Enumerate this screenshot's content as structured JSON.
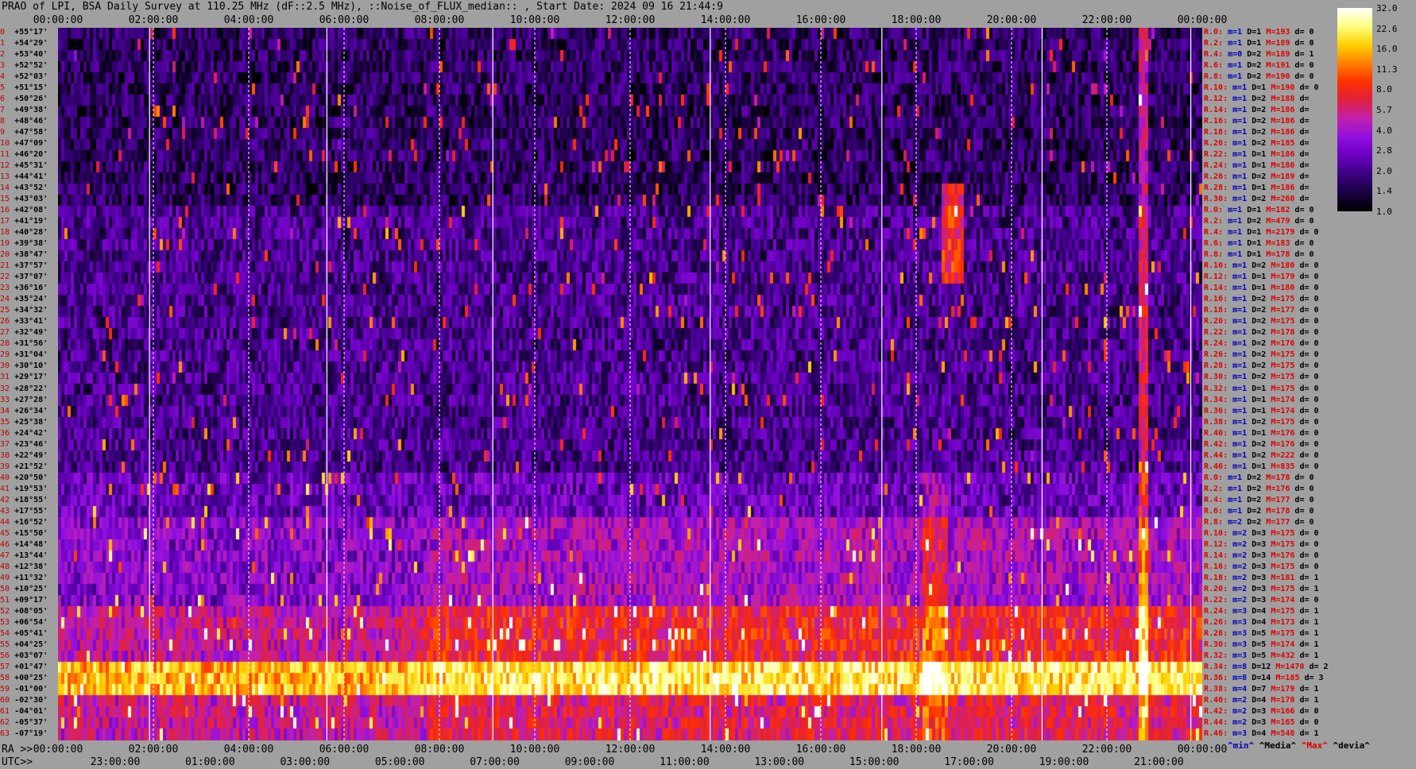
{
  "title": "PRAO of LPI, BSA Daily Survey at 110.25 MHz (dF::2.5 MHz), ::Noise_of_FLUX_median:: , Start Date: 2024 09 16 21:44:9",
  "top_axis": [
    "00:00:00",
    "02:00:00",
    "04:00:00",
    "06:00:00",
    "08:00:00",
    "10:00:00",
    "12:00:00",
    "14:00:00",
    "16:00:00",
    "18:00:00",
    "20:00:00",
    "22:00:00",
    "00:00:00"
  ],
  "ra_prefix": "RA >>",
  "ra_axis": [
    "00:00:00",
    "02:00:00",
    "04:00:00",
    "06:00:00",
    "08:00:00",
    "10:00:00",
    "12:00:00",
    "14:00:00",
    "16:00:00",
    "18:00:00",
    "20:00:00",
    "22:00:00",
    "00:00:00"
  ],
  "utc_prefix": "UTC>>",
  "utc_axis": [
    "23:00:00",
    "01:00:00",
    "03:00:00",
    "05:00:00",
    "07:00:00",
    "09:00:00",
    "11:00:00",
    "13:00:00",
    "15:00:00",
    "17:00:00",
    "19:00:00",
    "21:00:00"
  ],
  "declinations": [
    "+55°17'",
    "+54°29'",
    "+53°40'",
    "+52°52'",
    "+52°03'",
    "+51°15'",
    "+50°26'",
    "+49°38'",
    "+48°46'",
    "+47°58'",
    "+47°09'",
    "+46°20'",
    "+45°31'",
    "+44°41'",
    "+43°52'",
    "+43°03'",
    "+42°08'",
    "+41°19'",
    "+40°28'",
    "+39°38'",
    "+38°47'",
    "+37°57'",
    "+37°07'",
    "+36°16'",
    "+35°24'",
    "+34°32'",
    "+33°41'",
    "+32°49'",
    "+31°56'",
    "+31°04'",
    "+30°10'",
    "+29°17'",
    "+28°22'",
    "+27°28'",
    "+26°34'",
    "+25°38'",
    "+24°42'",
    "+23°46'",
    "+22°49'",
    "+21°52'",
    "+20°50'",
    "+19°53'",
    "+18°55'",
    "+17°55'",
    "+16°52'",
    "+15°50'",
    "+14°48'",
    "+13°44'",
    "+12°38'",
    "+11°32'",
    "+10°25'",
    "+09°17'",
    "+08°05'",
    "+06°54'",
    "+05°41'",
    "+04°25'",
    "+03°07'",
    "+01°47'",
    "+00°25'",
    "-01°00'",
    "-02°30'",
    "-04°01'",
    "-05°37'",
    "-07°19'"
  ],
  "row_indices": [
    "0",
    "1",
    "2",
    "3",
    "4",
    "5",
    "6",
    "7",
    "8",
    "9",
    "10",
    "11",
    "12",
    "13",
    "14",
    "15",
    "16",
    "17",
    "18",
    "19",
    "20",
    "21",
    "22",
    "23",
    "24",
    "25",
    "26",
    "27",
    "28",
    "29",
    "30",
    "31",
    "32",
    "33",
    "34",
    "35",
    "36",
    "37",
    "38",
    "39",
    "40",
    "41",
    "42",
    "43",
    "44",
    "45",
    "46",
    "47",
    "48",
    "49",
    "50",
    "51",
    "52",
    "53",
    "54",
    "55",
    "56",
    "57",
    "58",
    "59",
    "60",
    "61",
    "62",
    "63"
  ],
  "stats_rows": [
    {
      "r": "R.0:",
      "m": "m=1",
      "d": "D=1",
      "M": "M=193",
      "dd": "d= 0"
    },
    {
      "r": "R.2:",
      "m": "m=1",
      "d": "D=1",
      "M": "M=189",
      "dd": "d= 0"
    },
    {
      "r": "R.4:",
      "m": "m=0",
      "d": "D=2",
      "M": "M=189",
      "dd": "d= 1"
    },
    {
      "r": "R.6:",
      "m": "m=1",
      "d": "D=2",
      "M": "M=191",
      "dd": "d= 0"
    },
    {
      "r": "R.8:",
      "m": "m=1",
      "d": "D=2",
      "M": "M=190",
      "dd": "d= 0"
    },
    {
      "r": "R.10:",
      "m": "m=1",
      "d": "D=1",
      "M": "M=190",
      "dd": "d= 0"
    },
    {
      "r": "R.12:",
      "m": "m=1",
      "d": "D=2",
      "M": "M=188",
      "dd": "d="
    },
    {
      "r": "R.14:",
      "m": "m=1",
      "d": "D=2",
      "M": "M=186",
      "dd": "d="
    },
    {
      "r": "R.16:",
      "m": "m=1",
      "d": "D=2",
      "M": "M=186",
      "dd": "d="
    },
    {
      "r": "R.18:",
      "m": "m=1",
      "d": "D=2",
      "M": "M=186",
      "dd": "d="
    },
    {
      "r": "R.20:",
      "m": "m=1",
      "d": "D=2",
      "M": "M=185",
      "dd": "d="
    },
    {
      "r": "R.22:",
      "m": "m=1",
      "d": "D=1",
      "M": "M=186",
      "dd": "d="
    },
    {
      "r": "R.24:",
      "m": "m=1",
      "d": "D=1",
      "M": "M=186",
      "dd": "d="
    },
    {
      "r": "R.26:",
      "m": "m=1",
      "d": "D=2",
      "M": "M=189",
      "dd": "d="
    },
    {
      "r": "R.28:",
      "m": "m=1",
      "d": "D=1",
      "M": "M=186",
      "dd": "d="
    },
    {
      "r": "R.30:",
      "m": "m=1",
      "d": "D=2",
      "M": "M=260",
      "dd": "d="
    },
    {
      "r": "R.0:",
      "m": "m=1",
      "d": "D=1",
      "M": "M=182",
      "dd": "d= 0"
    },
    {
      "r": "R.2:",
      "m": "m=1",
      "d": "D=2",
      "M": "M=479",
      "dd": "d= 0"
    },
    {
      "r": "R.4:",
      "m": "m=1",
      "d": "D=1",
      "M": "M=2179",
      "dd": "d= 0"
    },
    {
      "r": "R.6:",
      "m": "m=1",
      "d": "D=1",
      "M": "M=183",
      "dd": "d= 0"
    },
    {
      "r": "R.8:",
      "m": "m=1",
      "d": "D=1",
      "M": "M=178",
      "dd": "d= 0"
    },
    {
      "r": "R.10:",
      "m": "m=1",
      "d": "D=2",
      "M": "M=180",
      "dd": "d= 0"
    },
    {
      "r": "R.12:",
      "m": "m=1",
      "d": "D=1",
      "M": "M=179",
      "dd": "d= 0"
    },
    {
      "r": "R.14:",
      "m": "m=1",
      "d": "D=1",
      "M": "M=180",
      "dd": "d= 0"
    },
    {
      "r": "R.16:",
      "m": "m=1",
      "d": "D=2",
      "M": "M=175",
      "dd": "d= 0"
    },
    {
      "r": "R.18:",
      "m": "m=1",
      "d": "D=2",
      "M": "M=177",
      "dd": "d= 0"
    },
    {
      "r": "R.20:",
      "m": "m=1",
      "d": "D=2",
      "M": "M=175",
      "dd": "d= 0"
    },
    {
      "r": "R.22:",
      "m": "m=1",
      "d": "D=2",
      "M": "M=178",
      "dd": "d= 0"
    },
    {
      "r": "R.24:",
      "m": "m=1",
      "d": "D=2",
      "M": "M=176",
      "dd": "d= 0"
    },
    {
      "r": "R.26:",
      "m": "m=1",
      "d": "D=2",
      "M": "M=175",
      "dd": "d= 0"
    },
    {
      "r": "R.28:",
      "m": "m=1",
      "d": "D=2",
      "M": "M=175",
      "dd": "d= 0"
    },
    {
      "r": "R.30:",
      "m": "m=1",
      "d": "D=2",
      "M": "M=175",
      "dd": "d= 0"
    },
    {
      "r": "R.32:",
      "m": "m=1",
      "d": "D=1",
      "M": "M=175",
      "dd": "d= 0"
    },
    {
      "r": "R.34:",
      "m": "m=1",
      "d": "D=1",
      "M": "M=174",
      "dd": "d= 0"
    },
    {
      "r": "R.36:",
      "m": "m=1",
      "d": "D=1",
      "M": "M=174",
      "dd": "d= 0"
    },
    {
      "r": "R.38:",
      "m": "m=1",
      "d": "D=2",
      "M": "M=175",
      "dd": "d= 0"
    },
    {
      "r": "R.40:",
      "m": "m=1",
      "d": "D=1",
      "M": "M=176",
      "dd": "d= 0"
    },
    {
      "r": "R.42:",
      "m": "m=1",
      "d": "D=2",
      "M": "M=176",
      "dd": "d= 0"
    },
    {
      "r": "R.44:",
      "m": "m=1",
      "d": "D=2",
      "M": "M=222",
      "dd": "d= 0"
    },
    {
      "r": "R.46:",
      "m": "m=1",
      "d": "D=1",
      "M": "M=835",
      "dd": "d= 0"
    },
    {
      "r": "R.0:",
      "m": "m=1",
      "d": "D=2",
      "M": "M=178",
      "dd": "d= 0"
    },
    {
      "r": "R.2:",
      "m": "m=1",
      "d": "D=2",
      "M": "M=176",
      "dd": "d= 0"
    },
    {
      "r": "R.4:",
      "m": "m=1",
      "d": "D=2",
      "M": "M=177",
      "dd": "d= 0"
    },
    {
      "r": "R.6:",
      "m": "m=1",
      "d": "D=2",
      "M": "M=178",
      "dd": "d= 0"
    },
    {
      "r": "R.8:",
      "m": "m=2",
      "d": "D=2",
      "M": "M=177",
      "dd": "d= 0"
    },
    {
      "r": "R.10:",
      "m": "m=2",
      "d": "D=3",
      "M": "M=175",
      "dd": "d= 0"
    },
    {
      "r": "R.12:",
      "m": "m=2",
      "d": "D=3",
      "M": "M=175",
      "dd": "d= 0"
    },
    {
      "r": "R.14:",
      "m": "m=2",
      "d": "D=3",
      "M": "M=176",
      "dd": "d= 0"
    },
    {
      "r": "R.16:",
      "m": "m=2",
      "d": "D=3",
      "M": "M=175",
      "dd": "d= 0"
    },
    {
      "r": "R.18:",
      "m": "m=2",
      "d": "D=3",
      "M": "M=181",
      "dd": "d= 1"
    },
    {
      "r": "R.20:",
      "m": "m=2",
      "d": "D=3",
      "M": "M=175",
      "dd": "d= 1"
    },
    {
      "r": "R.22:",
      "m": "m=2",
      "d": "D=3",
      "M": "M=174",
      "dd": "d= 0"
    },
    {
      "r": "R.24:",
      "m": "m=3",
      "d": "D=4",
      "M": "M=175",
      "dd": "d= 1"
    },
    {
      "r": "R.26:",
      "m": "m=3",
      "d": "D=4",
      "M": "M=173",
      "dd": "d= 1"
    },
    {
      "r": "R.28:",
      "m": "m=3",
      "d": "D=5",
      "M": "M=175",
      "dd": "d= 1"
    },
    {
      "r": "R.30:",
      "m": "m=3",
      "d": "D=5",
      "M": "M=174",
      "dd": "d= 1"
    },
    {
      "r": "R.32:",
      "m": "m=3",
      "d": "D=5",
      "M": "M=432",
      "dd": "d= 1"
    },
    {
      "r": "R.34:",
      "m": "m=8",
      "d": "D=12",
      "M": "M=1470",
      "dd": "d= 2"
    },
    {
      "r": "R.36:",
      "m": "m=8",
      "d": "D=14",
      "M": "M=185",
      "dd": "d= 3"
    },
    {
      "r": "R.38:",
      "m": "m=4",
      "d": "D=7",
      "M": "M=179",
      "dd": "d= 1"
    },
    {
      "r": "R.40:",
      "m": "m=2",
      "d": "D=4",
      "M": "M=170",
      "dd": "d= 1"
    },
    {
      "r": "R.42:",
      "m": "m=2",
      "d": "D=3",
      "M": "M=166",
      "dd": "d= 0"
    },
    {
      "r": "R.44:",
      "m": "m=2",
      "d": "D=3",
      "M": "M=165",
      "dd": "d= 0"
    },
    {
      "r": "R.46:",
      "m": "m=3",
      "d": "D=4",
      "M": "M=548",
      "dd": "d= 1"
    }
  ],
  "colorbar": {
    "ticks": [
      "32.0",
      "22.6",
      "16.0",
      "11.3",
      "8.0",
      "5.7",
      "4.0",
      "2.8",
      "2.0",
      "1.4",
      "1.0"
    ],
    "stops": [
      "#000000",
      "#1a0040",
      "#3a0080",
      "#6a00c0",
      "#9010e0",
      "#c020b0",
      "#e02040",
      "#ff3000",
      "#ff8000",
      "#ffd000",
      "#ffff80",
      "#ffffff"
    ]
  },
  "legend": {
    "min": "^min^",
    "median": "^Media^",
    "max": "^Max^",
    "dev": "^devia^"
  },
  "chart_data": {
    "type": "heatmap",
    "title": "PRAO of LPI, BSA Daily Survey at 110.25 MHz (dF::2.5 MHz), ::Noise_of_FLUX_median:: , Start Date: 2024 09 16 21:44:9",
    "x_ticks_top": [
      "00:00:00",
      "02:00:00",
      "04:00:00",
      "06:00:00",
      "08:00:00",
      "10:00:00",
      "12:00:00",
      "14:00:00",
      "16:00:00",
      "18:00:00",
      "20:00:00",
      "22:00:00",
      "00:00:00"
    ],
    "x_ticks_ra": [
      "00:00:00",
      "02:00:00",
      "04:00:00",
      "06:00:00",
      "08:00:00",
      "10:00:00",
      "12:00:00",
      "14:00:00",
      "16:00:00",
      "18:00:00",
      "20:00:00",
      "22:00:00",
      "00:00:00"
    ],
    "x_ticks_utc": [
      "23:00:00",
      "01:00:00",
      "03:00:00",
      "05:00:00",
      "07:00:00",
      "09:00:00",
      "11:00:00",
      "13:00:00",
      "15:00:00",
      "17:00:00",
      "19:00:00",
      "21:00:00"
    ],
    "rows": 64,
    "color_scale": "log",
    "color_range": [
      1.0,
      32.0
    ],
    "bands": [
      {
        "rows": [
          0,
          15
        ],
        "level": 1.6
      },
      {
        "rows": [
          16,
          39
        ],
        "level": 2.0
      },
      {
        "rows": [
          40,
          43
        ],
        "level": 2.6
      },
      {
        "rows": [
          44,
          51
        ],
        "level": 3.2
      },
      {
        "rows": [
          52,
          56
        ],
        "level": 6.0
      },
      {
        "rows": [
          57,
          59
        ],
        "level": 16.0
      },
      {
        "rows": [
          60,
          63
        ],
        "level": 5.0
      }
    ]
  }
}
